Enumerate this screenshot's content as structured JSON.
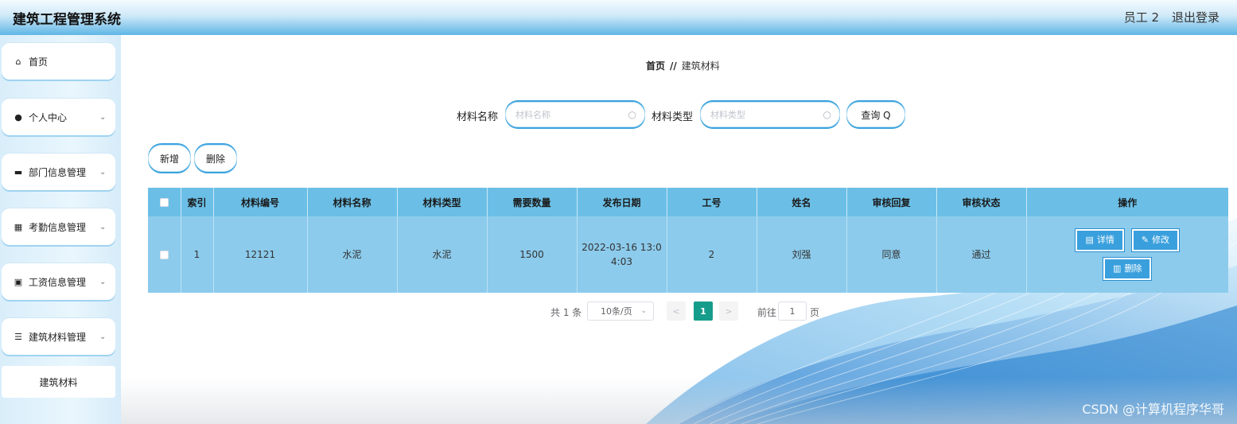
{
  "app": {
    "title": "建筑工程管理系统"
  },
  "header": {
    "user": "员工 2",
    "logout": "退出登录"
  },
  "sidebar": {
    "items": [
      {
        "label": "首页",
        "icon": "home-icon",
        "glyph": "⌂",
        "has_chevron": false
      },
      {
        "label": "个人中心",
        "icon": "user-icon",
        "glyph": "●",
        "has_chevron": true
      },
      {
        "label": "部门信息管理",
        "icon": "comment-icon",
        "glyph": "▬",
        "has_chevron": true
      },
      {
        "label": "考勤信息管理",
        "icon": "grid-icon",
        "glyph": "▦",
        "has_chevron": true
      },
      {
        "label": "工资信息管理",
        "icon": "clipboard-icon",
        "glyph": "▣",
        "has_chevron": true
      },
      {
        "label": "建筑材料管理",
        "icon": "list-icon",
        "glyph": "☰",
        "has_chevron": true
      }
    ],
    "sub_item": "建筑材料",
    "chevron": "⌄"
  },
  "breadcrumb": {
    "home": "首页",
    "sep": "//",
    "current": "建筑材料"
  },
  "search": {
    "name_label": "材料名称",
    "name_placeholder": "材料名称",
    "type_label": "材料类型",
    "type_placeholder": "材料类型",
    "query_button": "查询 Q"
  },
  "actions": {
    "add": "新增",
    "delete": "删除"
  },
  "table": {
    "headers": [
      "索引",
      "材料编号",
      "材料名称",
      "材料类型",
      "需要数量",
      "发布日期",
      "工号",
      "姓名",
      "审核回复",
      "审核状态",
      "操作"
    ],
    "rows": [
      {
        "index": "1",
        "code": "12121",
        "name": "水泥",
        "type": "水泥",
        "quantity": "1500",
        "date_line1": "2022-03-16 13:0",
        "date_line2": "4:03",
        "worker_id": "2",
        "person": "刘强",
        "reply": "同意",
        "status": "通过",
        "ops": {
          "detail": "详情",
          "edit": "修改",
          "delete": "删除"
        }
      }
    ]
  },
  "pagination": {
    "total": "共 1 条",
    "page_size": "10条/页",
    "prev": "<",
    "current": "1",
    "next": ">",
    "goto_label": "前往",
    "goto_value": "1",
    "page_unit": "页"
  },
  "watermark": "CSDN @计算机程序华哥",
  "colors": {
    "accent": "#3aa0dd",
    "table_header": "#6bbfe6",
    "table_row": "#8ccbec",
    "pager_current": "#169c8a"
  }
}
